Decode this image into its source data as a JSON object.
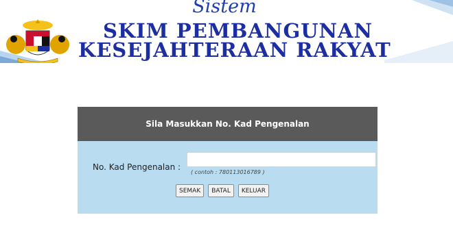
{
  "header": {
    "line1": "Sistem",
    "line2": "SKIM PEMBANGUNAN",
    "line3": "KESEJAHTERAAN RAKYAT"
  },
  "form": {
    "heading": "Sila Masukkan No. Kad Pengenalan",
    "ic_label": "No. Kad Pengenalan :",
    "ic_value": "",
    "ic_hint": "( contoh : 780113016789 )",
    "buttons": {
      "check": "SEMAK",
      "cancel": "BATAL",
      "exit": "KELUAR"
    }
  },
  "colors": {
    "header_bar": "#5a5a5a",
    "form_body": "#b9dcf1",
    "title_blue": "#1d2fa0"
  }
}
